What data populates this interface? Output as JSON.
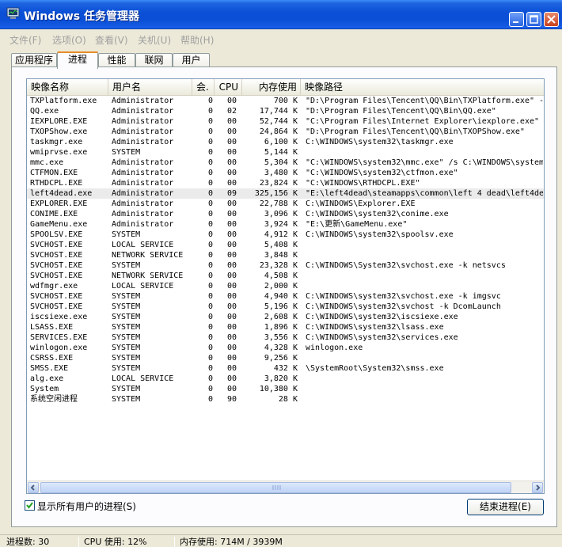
{
  "window": {
    "title": "Windows 任务管理器",
    "controls": {
      "minimize": "minimize",
      "maximize": "maximize",
      "close": "close"
    }
  },
  "menu": [
    "文件(F)",
    "选项(O)",
    "查看(V)",
    "关机(U)",
    "帮助(H)"
  ],
  "tabs": [
    {
      "label": "应用程序",
      "active": false
    },
    {
      "label": "进程",
      "active": true
    },
    {
      "label": "性能",
      "active": false
    },
    {
      "label": "联网",
      "active": false
    },
    {
      "label": "用户",
      "active": false
    }
  ],
  "columns": [
    "映像名称",
    "用户名",
    "会.",
    "CPU",
    "内存使用",
    "映像路径"
  ],
  "processes": [
    [
      "TXPlatform.exe",
      "Administrator",
      "0",
      "00",
      "700 K",
      "\"D:\\Program Files\\Tencent\\QQ\\Bin\\TXPlatform.exe\" -"
    ],
    [
      "QQ.exe",
      "Administrator",
      "0",
      "02",
      "17,744 K",
      "\"D:\\Program Files\\Tencent\\QQ\\Bin\\QQ.exe\""
    ],
    [
      "IEXPLORE.EXE",
      "Administrator",
      "0",
      "00",
      "52,744 K",
      "\"C:\\Program Files\\Internet Explorer\\iexplore.exe\""
    ],
    [
      "TXOPShow.exe",
      "Administrator",
      "0",
      "00",
      "24,864 K",
      "\"D:\\Program Files\\Tencent\\QQ\\Bin\\TXOPShow.exe\""
    ],
    [
      "taskmgr.exe",
      "Administrator",
      "0",
      "00",
      "6,100 K",
      "C:\\WINDOWS\\system32\\taskmgr.exe"
    ],
    [
      "wmiprvse.exe",
      "SYSTEM",
      "0",
      "00",
      "5,144 K",
      ""
    ],
    [
      "mmc.exe",
      "Administrator",
      "0",
      "00",
      "5,304 K",
      "\"C:\\WINDOWS\\system32\\mmc.exe\" /s C:\\WINDOWS\\system"
    ],
    [
      "CTFMON.EXE",
      "Administrator",
      "0",
      "00",
      "3,480 K",
      "\"C:\\WINDOWS\\system32\\ctfmon.exe\""
    ],
    [
      "RTHDCPL.EXE",
      "Administrator",
      "0",
      "00",
      "23,824 K",
      "\"C:\\WINDOWS\\RTHDCPL.EXE\""
    ],
    [
      "left4dead.exe",
      "Administrator",
      "0",
      "09",
      "325,156 K",
      "\"E:\\left4dead\\steamapps\\common\\left 4 dead\\left4de"
    ],
    [
      "EXPLORER.EXE",
      "Administrator",
      "0",
      "00",
      "22,788 K",
      "C:\\WINDOWS\\Explorer.EXE"
    ],
    [
      "CONIME.EXE",
      "Administrator",
      "0",
      "00",
      "3,096 K",
      "C:\\WINDOWS\\system32\\conime.exe"
    ],
    [
      "GameMenu.exe",
      "Administrator",
      "0",
      "00",
      "3,924 K",
      "\"E:\\更新\\GameMenu.exe\""
    ],
    [
      "SPOOLSV.EXE",
      "SYSTEM",
      "0",
      "00",
      "4,912 K",
      "C:\\WINDOWS\\system32\\spoolsv.exe"
    ],
    [
      "SVCHOST.EXE",
      "LOCAL SERVICE",
      "0",
      "00",
      "5,408 K",
      ""
    ],
    [
      "SVCHOST.EXE",
      "NETWORK SERVICE",
      "0",
      "00",
      "3,848 K",
      ""
    ],
    [
      "SVCHOST.EXE",
      "SYSTEM",
      "0",
      "00",
      "23,328 K",
      "C:\\WINDOWS\\System32\\svchost.exe -k netsvcs"
    ],
    [
      "SVCHOST.EXE",
      "NETWORK SERVICE",
      "0",
      "00",
      "4,508 K",
      ""
    ],
    [
      "wdfmgr.exe",
      "LOCAL SERVICE",
      "0",
      "00",
      "2,000 K",
      ""
    ],
    [
      "SVCHOST.EXE",
      "SYSTEM",
      "0",
      "00",
      "4,940 K",
      "C:\\WINDOWS\\system32\\svchost.exe -k imgsvc"
    ],
    [
      "SVCHOST.EXE",
      "SYSTEM",
      "0",
      "00",
      "5,196 K",
      "C:\\WINDOWS\\system32\\svchost -k DcomLaunch"
    ],
    [
      "iscsiexe.exe",
      "SYSTEM",
      "0",
      "00",
      "2,608 K",
      "C:\\WINDOWS\\system32\\iscsiexe.exe"
    ],
    [
      "LSASS.EXE",
      "SYSTEM",
      "0",
      "00",
      "1,896 K",
      "C:\\WINDOWS\\system32\\lsass.exe"
    ],
    [
      "SERVICES.EXE",
      "SYSTEM",
      "0",
      "00",
      "3,556 K",
      "C:\\WINDOWS\\system32\\services.exe"
    ],
    [
      "winlogon.exe",
      "SYSTEM",
      "0",
      "00",
      "4,328 K",
      "winlogon.exe"
    ],
    [
      "CSRSS.EXE",
      "SYSTEM",
      "0",
      "00",
      "9,256 K",
      ""
    ],
    [
      "SMSS.EXE",
      "SYSTEM",
      "0",
      "00",
      "432 K",
      "\\SystemRoot\\System32\\smss.exe"
    ],
    [
      "alg.exe",
      "LOCAL SERVICE",
      "0",
      "00",
      "3,820 K",
      ""
    ],
    [
      "System",
      "SYSTEM",
      "0",
      "00",
      "10,380 K",
      ""
    ],
    [
      "系统空闲进程",
      "SYSTEM",
      "0",
      "90",
      "28 K",
      ""
    ]
  ],
  "selected_process": "left4dead.exe",
  "show_all_users": {
    "label": "显示所有用户的进程(S)",
    "checked": true
  },
  "end_process_button": "结束进程(E)",
  "status": {
    "processes": "进程数: 30",
    "cpu": "CPU 使用: 12%",
    "memory": "内存使用: 714M / 3939M"
  },
  "colors": {
    "titlebar": "#0a4fd6",
    "active_tab_accent": "#e68b2c",
    "selected_row": "#ebebeb"
  }
}
